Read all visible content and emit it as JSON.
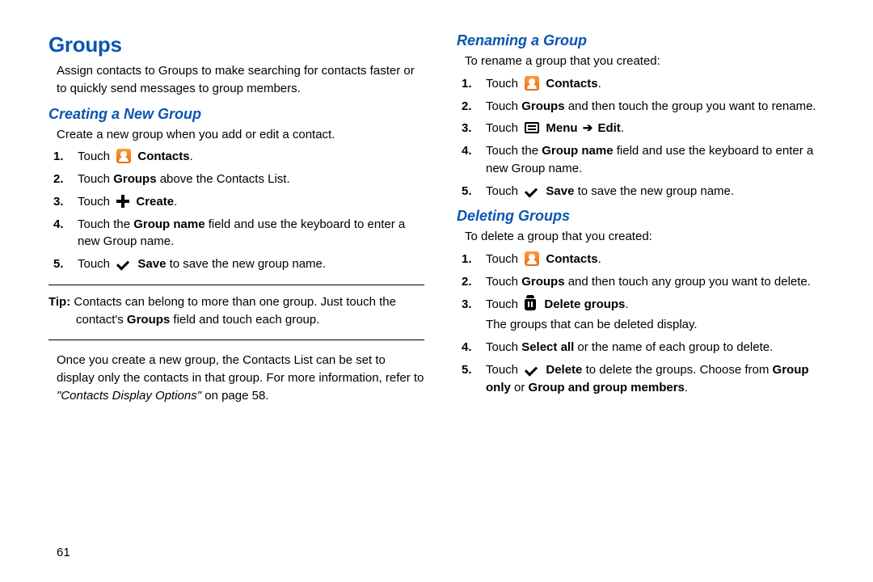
{
  "page_number": "61",
  "title": "Groups",
  "intro": "Assign contacts to Groups to make searching for contacts faster or to quickly send messages to group members.",
  "creating": {
    "heading": "Creating a New Group",
    "lead": "Create a new group when you add or edit a contact.",
    "s1_a": "Touch",
    "s1_b": "Contacts",
    "s1_c": ".",
    "s2_a": "Touch ",
    "s2_b": "Groups",
    "s2_c": " above the Contacts List.",
    "s3_a": "Touch",
    "s3_b": "Create",
    "s3_c": ".",
    "s4_a": "Touch the ",
    "s4_b": "Group name",
    "s4_c": " field and use the keyboard to enter a new Group name.",
    "s5_a": "Touch",
    "s5_b": "Save",
    "s5_c": " to save the new group name."
  },
  "tip": {
    "label": "Tip:",
    "text": " Contacts can belong to more than one group. Just touch the contact's ",
    "b": "Groups",
    "text2": " field and touch each group."
  },
  "after_tip_a": "Once you create a new group, the Contacts List can be set to display only the contacts in that group. For more information, refer to ",
  "after_tip_ital": "\"Contacts Display Options\"",
  "after_tip_b": " on page 58.",
  "renaming": {
    "heading": "Renaming a Group",
    "lead": "To rename a group that you created:",
    "s1_a": "Touch",
    "s1_b": "Contacts",
    "s1_c": ".",
    "s2_a": "Touch ",
    "s2_b": "Groups",
    "s2_c": " and then touch the group you want to rename.",
    "s3_a": "Touch",
    "s3_b": "Menu",
    "s3_arrow": "➔",
    "s3_c": "Edit",
    "s3_d": ".",
    "s4_a": "Touch the ",
    "s4_b": "Group name",
    "s4_c": " field and use the keyboard to enter a new Group name.",
    "s5_a": "Touch",
    "s5_b": "Save",
    "s5_c": " to save the new group name."
  },
  "deleting": {
    "heading": "Deleting Groups",
    "lead": "To delete a group that you created:",
    "s1_a": "Touch",
    "s1_b": "Contacts",
    "s1_c": ".",
    "s2_a": "Touch ",
    "s2_b": "Groups",
    "s2_c": " and then touch any group you want to delete.",
    "s3_a": "Touch",
    "s3_b": "Delete groups",
    "s3_c": ".",
    "s3_sub": "The groups that can be deleted display.",
    "s4_a": "Touch ",
    "s4_b": "Select all",
    "s4_c": " or the name of each group to delete.",
    "s5_a": "Touch",
    "s5_b": "Delete",
    "s5_c": " to delete the groups. Choose from ",
    "s5_d": "Group only",
    "s5_e": " or ",
    "s5_f": "Group and group members",
    "s5_g": "."
  }
}
